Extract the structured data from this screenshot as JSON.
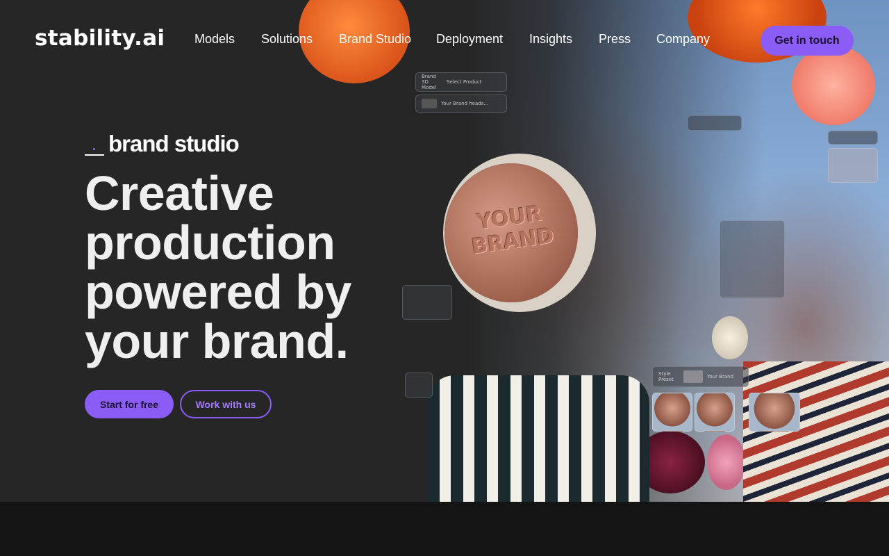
{
  "header": {
    "logo": "stability.ai",
    "nav": [
      "Models",
      "Solutions",
      "Brand Studio",
      "Deployment",
      "Insights",
      "Press",
      "Company"
    ],
    "cta": "Get in touch"
  },
  "hero": {
    "brand_label": "brand studio",
    "headline": [
      "Creative",
      "production",
      "powered by",
      "your brand."
    ],
    "primary_button": "Start for free",
    "secondary_button": "Work with us",
    "image_text": {
      "headphone_logo": [
        "YOUR",
        "BRAND"
      ],
      "ui_brand_model_label": "Brand 3D Model",
      "ui_select_product": "Select Product",
      "ui_product_name": "Your Brand heads...",
      "ui_style_preset_label": "Style Preset",
      "ui_style_preset_value": "Your Brand"
    }
  },
  "colors": {
    "accent": "#8c5cf6",
    "background": "#262626",
    "footer_band": "#141414"
  }
}
